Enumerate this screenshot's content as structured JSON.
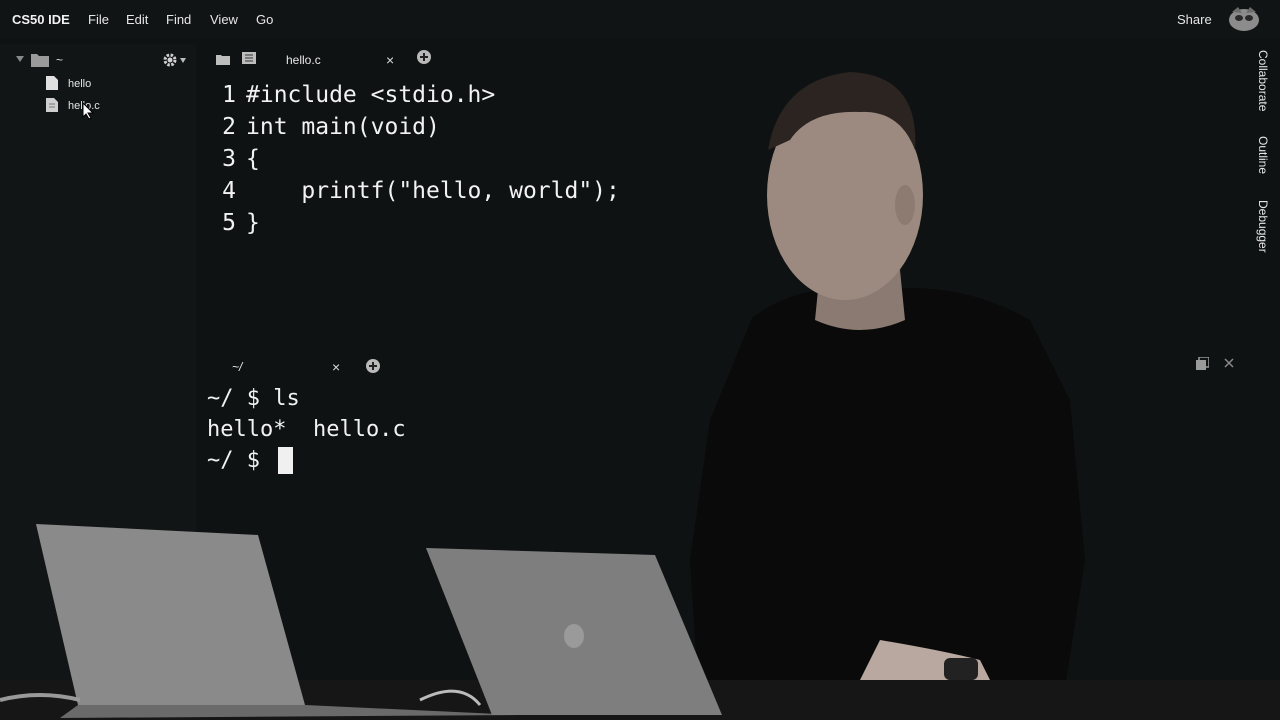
{
  "app": {
    "brand": "CS50 IDE",
    "menu": [
      "File",
      "Edit",
      "Find",
      "View",
      "Go"
    ],
    "share_label": "Share"
  },
  "sidebar": {
    "root_label": "~",
    "files": [
      {
        "name": "hello",
        "icon": "file-icon"
      },
      {
        "name": "hello.c",
        "icon": "c-file-icon"
      }
    ]
  },
  "editor": {
    "tab_label": "hello.c",
    "lines": [
      {
        "num": "1",
        "text": "#include <stdio.h>"
      },
      {
        "num": "2",
        "text": "int main(void)"
      },
      {
        "num": "3",
        "text": "{"
      },
      {
        "num": "4",
        "text": "    printf(\"hello, world\");"
      },
      {
        "num": "5",
        "text": "}"
      }
    ]
  },
  "terminal": {
    "tab_label": "~/",
    "lines": [
      "~/ $ ls",
      "hello*  hello.c",
      "~/ $ "
    ]
  },
  "right_panel": [
    "Collaborate",
    "Outline",
    "Debugger"
  ],
  "colors": {
    "background": "#0f1213",
    "text": "#f2f2f2",
    "accent_add": "#b9b9b9"
  }
}
